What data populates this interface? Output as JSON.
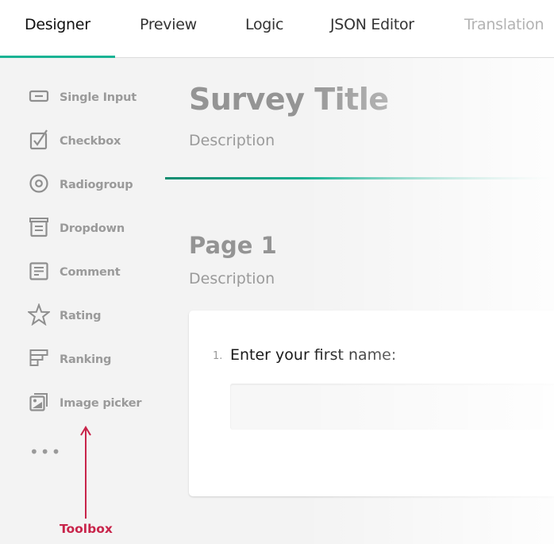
{
  "tabs": [
    {
      "label": "Designer",
      "active": true
    },
    {
      "label": "Preview",
      "active": false
    },
    {
      "label": "Logic",
      "active": false
    },
    {
      "label": "JSON Editor",
      "active": false
    },
    {
      "label": "Translation",
      "active": false
    }
  ],
  "toolbox": {
    "items": [
      {
        "label": "Single Input",
        "icon": "single-input-icon"
      },
      {
        "label": "Checkbox",
        "icon": "checkbox-icon"
      },
      {
        "label": "Radiogroup",
        "icon": "radiogroup-icon"
      },
      {
        "label": "Dropdown",
        "icon": "dropdown-icon"
      },
      {
        "label": "Comment",
        "icon": "comment-icon"
      },
      {
        "label": "Rating",
        "icon": "star-icon"
      },
      {
        "label": "Ranking",
        "icon": "ranking-icon"
      },
      {
        "label": "Image picker",
        "icon": "image-picker-icon"
      }
    ],
    "more": "•••",
    "annotation": "Toolbox"
  },
  "survey": {
    "title": "Survey Title",
    "description": "Description",
    "page": {
      "title": "Page 1",
      "description": "Description",
      "questions": [
        {
          "number": "1.",
          "title": "Enter your first name:",
          "value": ""
        }
      ]
    }
  },
  "colors": {
    "accent": "#1ab394",
    "annotation": "#c8244a"
  }
}
